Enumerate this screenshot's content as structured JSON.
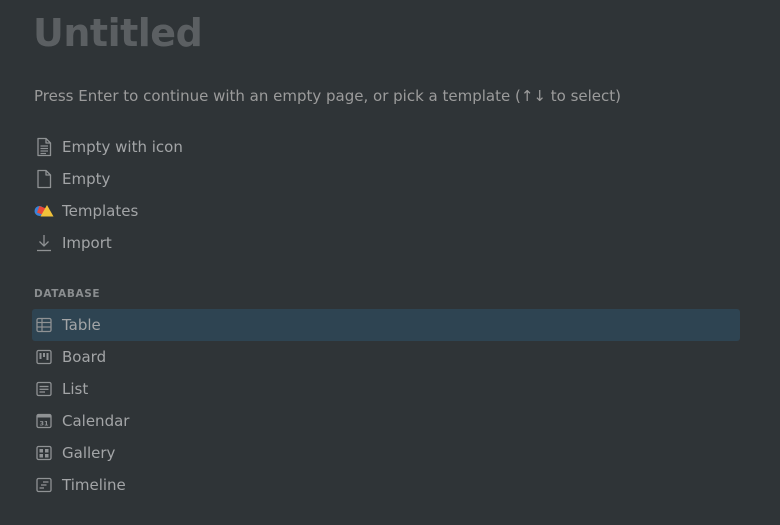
{
  "page": {
    "title": "Untitled",
    "hint": "Press Enter to continue with an empty page, or pick a template (↑↓ to select)"
  },
  "menu": {
    "items": [
      {
        "label": "Empty with icon",
        "icon": "page-with-lines-icon"
      },
      {
        "label": "Empty",
        "icon": "blank-page-icon"
      },
      {
        "label": "Templates",
        "icon": "templates-shapes-icon"
      },
      {
        "label": "Import",
        "icon": "download-arrow-icon"
      }
    ]
  },
  "database": {
    "heading": "DATABASE",
    "items": [
      {
        "label": "Table",
        "icon": "table-icon",
        "selected": true
      },
      {
        "label": "Board",
        "icon": "board-icon"
      },
      {
        "label": "List",
        "icon": "list-icon"
      },
      {
        "label": "Calendar",
        "icon": "calendar-icon",
        "icon_text": "31"
      },
      {
        "label": "Gallery",
        "icon": "gallery-icon"
      },
      {
        "label": "Timeline",
        "icon": "timeline-icon"
      }
    ]
  },
  "colors": {
    "background": "#2f3437",
    "selected_row": "#2e4452",
    "text": "#a3a5a7",
    "title": "#5b5f62"
  }
}
